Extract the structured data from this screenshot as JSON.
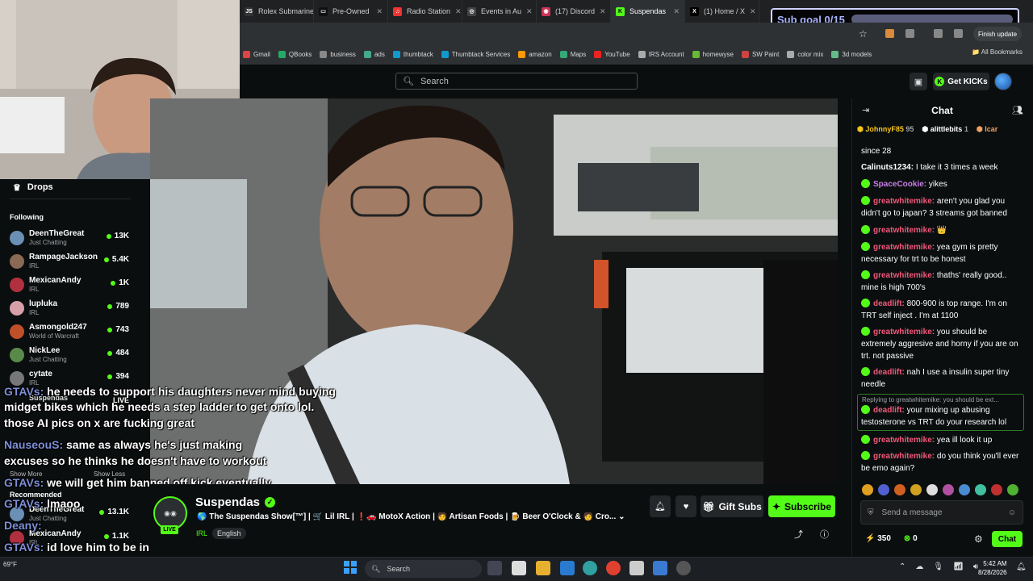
{
  "browser": {
    "tabs": [
      {
        "label": "Rolex Submariner",
        "fav": "JS",
        "color": "#333"
      },
      {
        "label": "Pre-Owned",
        "fav": "▭",
        "color": "#111"
      },
      {
        "label": "Radio Station",
        "fav": "♫",
        "color": "#e33"
      },
      {
        "label": "Events in Au",
        "fav": "◎",
        "color": "#444"
      },
      {
        "label": "(17) Discord",
        "fav": "◉",
        "color": "#c35"
      },
      {
        "label": "Suspendas",
        "fav": "K",
        "color": "#53fc18",
        "active": true
      },
      {
        "label": "(1) Home / X",
        "fav": "X",
        "color": "#000"
      }
    ],
    "finish_update": "Finish update",
    "bookmarks": [
      {
        "label": "Gmail",
        "color": "#d44"
      },
      {
        "label": "QBooks",
        "color": "#2a6"
      },
      {
        "label": "business",
        "color": "#888"
      },
      {
        "label": "ads",
        "color": "#4a8"
      },
      {
        "label": "thumbtack",
        "color": "#19c"
      },
      {
        "label": "Thumbtack Services",
        "color": "#19c"
      },
      {
        "label": "amazon",
        "color": "#f90"
      },
      {
        "label": "Maps",
        "color": "#3a7"
      },
      {
        "label": "YouTube",
        "color": "#e22"
      },
      {
        "label": "IRS Account",
        "color": "#aaa"
      },
      {
        "label": "homewyse",
        "color": "#6b3"
      },
      {
        "label": "SW Paint",
        "color": "#c44"
      },
      {
        "label": "color mix",
        "color": "#aaa"
      },
      {
        "label": "3d models",
        "color": "#6b8"
      }
    ],
    "all_bookmarks": "All Bookmarks"
  },
  "kick": {
    "search_placeholder": "Search",
    "get_kicks": "Get KICKs"
  },
  "sidebar": {
    "drops": "Drops",
    "following_label": "Following",
    "following": [
      {
        "name": "DeenTheGreat",
        "sub": "Just Chatting",
        "viewers": "13K",
        "color": "#6b8fb5"
      },
      {
        "name": "RampageJackson",
        "sub": "IRL",
        "viewers": "5.4K",
        "color": "#8a6a55"
      },
      {
        "name": "MexicanAndy",
        "sub": "IRL",
        "viewers": "1K",
        "color": "#b03040"
      },
      {
        "name": "lupluka",
        "sub": "IRL",
        "viewers": "789",
        "color": "#d7a0a8"
      },
      {
        "name": "Asmongold247",
        "sub": "World of Warcraft",
        "viewers": "743",
        "color": "#c0502a"
      },
      {
        "name": "NickLee",
        "sub": "Just Chatting",
        "viewers": "484",
        "color": "#5a8a4a"
      },
      {
        "name": "cytate",
        "sub": "IRL",
        "viewers": "394",
        "color": "#777"
      }
    ],
    "suspendas": "Suspendas",
    "live": "LIVE",
    "show_more": "Show More",
    "show_less": "Show Less",
    "recommended": "Recommended",
    "recommended_items": [
      {
        "name": "DeenTheGreat",
        "sub": "Just Chatting",
        "viewers": "13.1K",
        "color": "#6b8fb5"
      },
      {
        "name": "MexicanAndy",
        "sub": "IRL",
        "viewers": "1.1K",
        "color": "#b03040"
      }
    ]
  },
  "sub_goal": {
    "label": "Sub goal 0/15",
    "progress": 0.0
  },
  "overlay_chat": [
    {
      "user": "GTAVs:",
      "text": "he needs to support his daughters never mind buying"
    },
    {
      "user": "",
      "text": "midget bikes which he needs a step ladder to get onto lol."
    },
    {
      "user": "",
      "text": "those AI pics on x are fucking great"
    },
    {
      "user": "NauseouS:",
      "text": "same as always he's just making"
    },
    {
      "user": "",
      "text": "excuses so he thinks he doesn't have to workout"
    },
    {
      "user": "GTAVs:",
      "text": "we will get him banned off kick eventually"
    },
    {
      "user": "GTAVs:",
      "text": "lmaoo"
    },
    {
      "user": "Deany:",
      "text": ""
    },
    {
      "user": "GTAVs:",
      "text": "id love him to be in a fatal crash, I dont know why"
    }
  ],
  "stream": {
    "streamer": "Suspendas",
    "live": "LIVE",
    "title": "🌎 The Suspendas Show[™] | 🛒 Lil IRL | ❗🚗 MotoX Action | 🧑 Artisan Foods | 🍺 Beer O'Clock & 🧑 Cro...",
    "category": "IRL",
    "language": "English",
    "gift_subs": "Gift Subs",
    "subscribe": "Subscribe"
  },
  "chat": {
    "header": "Chat",
    "pinned": [
      {
        "name": "JohnnyF85",
        "count": "95",
        "color": "#f5c518"
      },
      {
        "name": "alittlebits",
        "count": "1",
        "color": "#fff"
      },
      {
        "name": "Icar",
        "count": "",
        "color": "#f0a060"
      }
    ],
    "messages": [
      {
        "user": "",
        "text": "since 28",
        "color": "#fff",
        "badge": false
      },
      {
        "user": "Calinuts1234:",
        "text": "I take it 3 times a week",
        "color": "#fff",
        "badge": false
      },
      {
        "user": "SpaceCookie:",
        "text": "yikes",
        "color": "#c87ee8",
        "badge": true
      },
      {
        "user": "greatwhitemike:",
        "text": "aren't you glad you didn't go to japan? 3 streams got banned",
        "color": "#f0587a",
        "badge": true
      },
      {
        "user": "greatwhitemike:",
        "text": "👑",
        "color": "#f0587a",
        "badge": true
      },
      {
        "user": "greatwhitemike:",
        "text": "yea gym is pretty necessary for trt to be honest",
        "color": "#f0587a",
        "badge": true
      },
      {
        "user": "greatwhitemike:",
        "text": "thaths' really good.. mine is high 700's",
        "color": "#f0587a",
        "badge": true
      },
      {
        "user": "deadlift:",
        "text": "800-900 is top range. I'm on TRT self inject . I'm at 1100",
        "color": "#f0587a",
        "badge": true
      },
      {
        "user": "greatwhitemike:",
        "text": "you should be extremely aggresive and horny if you are on trt. not passive",
        "color": "#f0587a",
        "badge": true
      },
      {
        "user": "deadlift:",
        "text": "nah I use a insulin super tiny needle",
        "color": "#f0587a",
        "badge": true
      },
      {
        "user": "deadlift:",
        "text": "your mixing up abusing testosterone vs TRT do your research lol",
        "color": "#f0587a",
        "badge": true
      },
      {
        "user": "greatwhitemike:",
        "text": "yea ill look it up",
        "color": "#f0587a",
        "badge": true
      },
      {
        "user": "greatwhitemike:",
        "text": "do you think you'll ever be emo again?",
        "color": "#f0587a",
        "badge": true
      }
    ],
    "reply_hint": "Replying to greatwhitemike: you should be ext...",
    "send_placeholder": "Send a message",
    "points": "350",
    "kicks": "0",
    "chat_button": "Chat"
  },
  "taskbar": {
    "search": "Search",
    "time": "5:42 AM",
    "date": "8/28/2026",
    "weather": "69°F"
  }
}
